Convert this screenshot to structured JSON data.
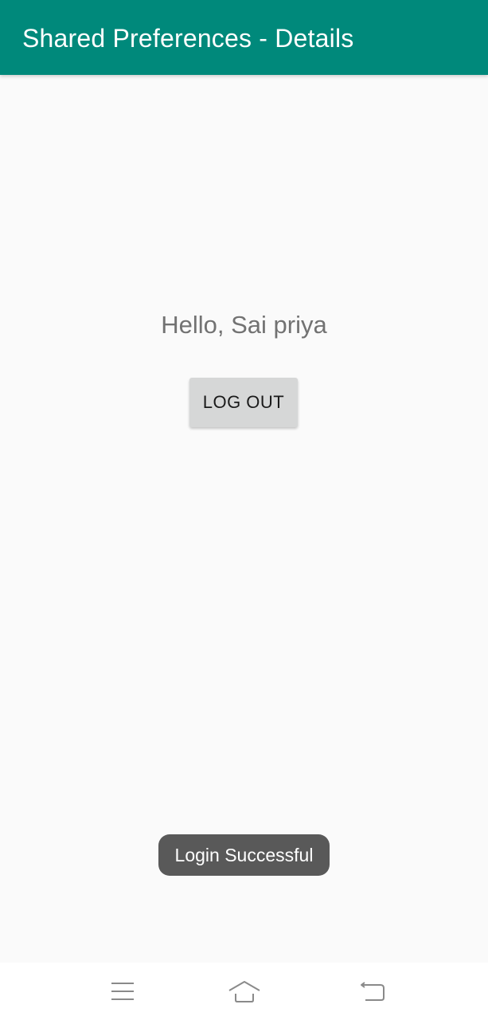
{
  "app_bar": {
    "title": "Shared Preferences - Details",
    "color": "#00897b"
  },
  "main": {
    "greeting": "Hello, Sai priya",
    "logout_label": "LOG OUT"
  },
  "toast": {
    "message": "Login Successful"
  },
  "nav_bar": {
    "icons": [
      "menu-icon",
      "home-icon",
      "back-icon"
    ]
  }
}
